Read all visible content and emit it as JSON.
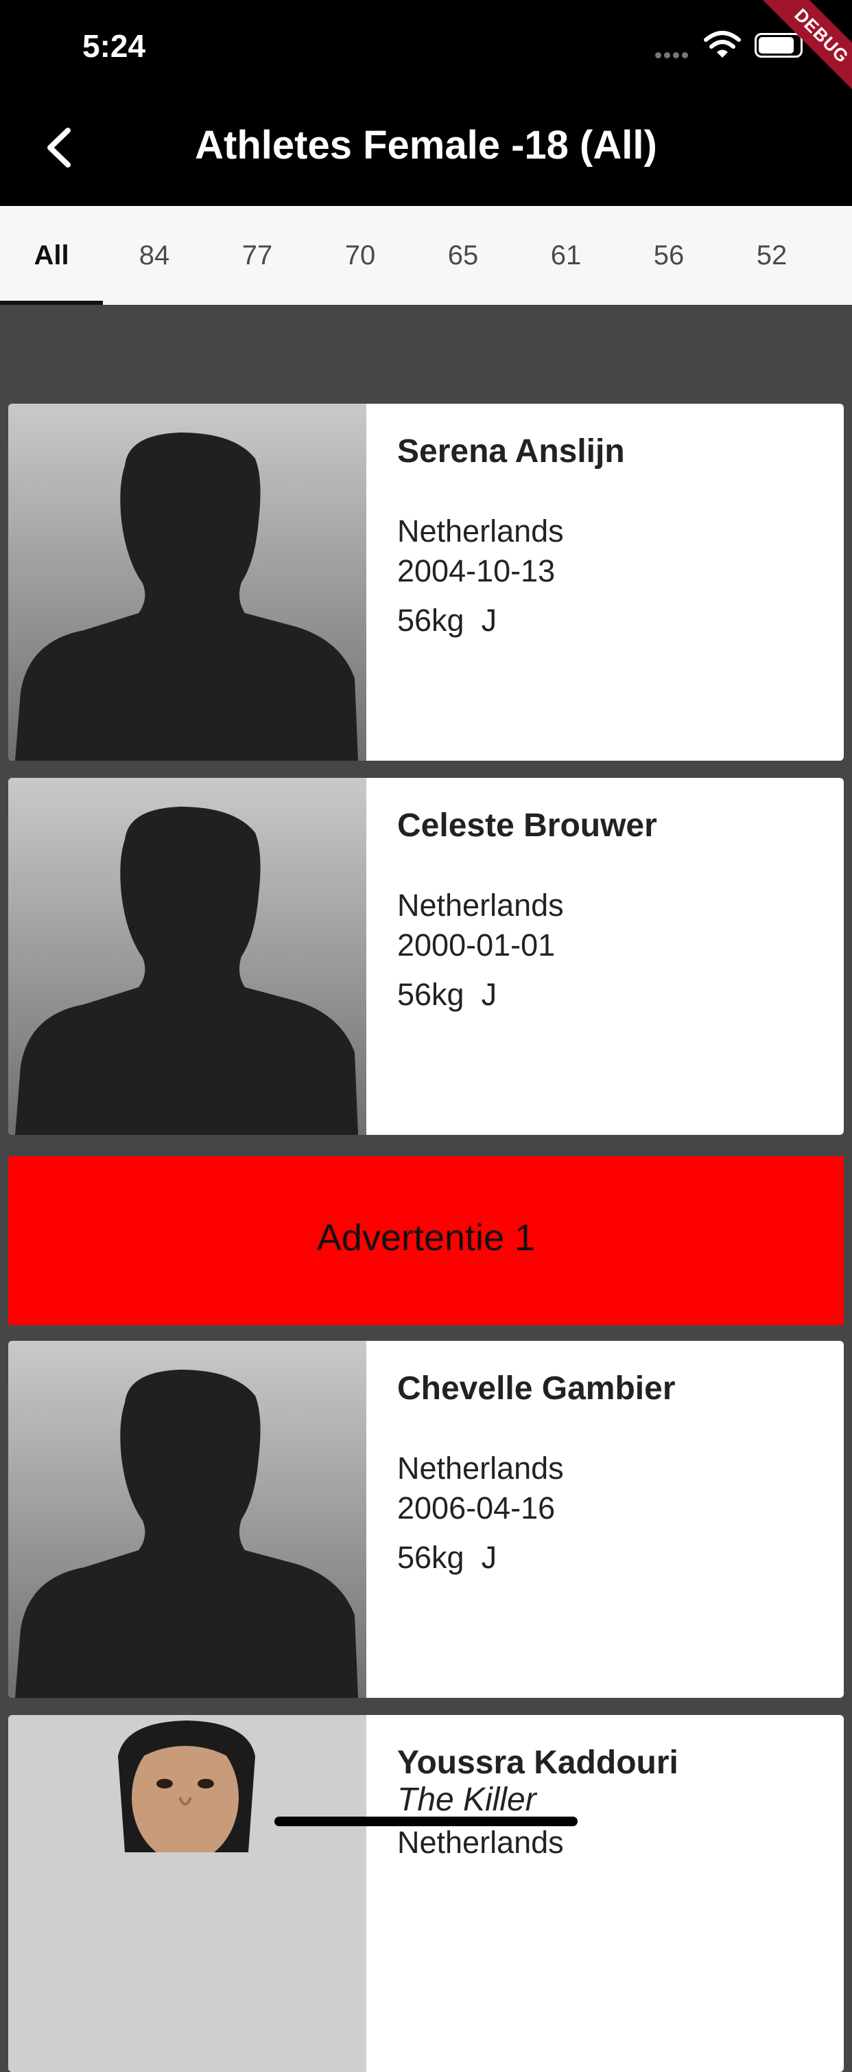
{
  "status_bar": {
    "time": "5:24",
    "debug_label": "DEBUG"
  },
  "app_bar": {
    "title": "Athletes Female -18 (All)",
    "back_icon": "chevron-left-icon"
  },
  "tabs": [
    {
      "label": "All",
      "active": true
    },
    {
      "label": "84"
    },
    {
      "label": "77"
    },
    {
      "label": "70"
    },
    {
      "label": "65"
    },
    {
      "label": "61"
    },
    {
      "label": "56"
    },
    {
      "label": "52"
    }
  ],
  "athletes": [
    {
      "name": "Serena Anslijn",
      "country": "Netherlands",
      "dob": "2004-10-13",
      "weight": "56kg",
      "category": "J",
      "photo": "placeholder"
    },
    {
      "name": "Celeste Brouwer",
      "country": "Netherlands",
      "dob": "2000-01-01",
      "weight": "56kg",
      "category": "J",
      "photo": "placeholder"
    },
    {
      "name": "Chevelle Gambier",
      "country": "Netherlands",
      "dob": "2006-04-16",
      "weight": "56kg",
      "category": "J",
      "photo": "placeholder"
    },
    {
      "name": "Youssra Kaddouri",
      "nickname": "The Killer",
      "country": "Netherlands",
      "photo": "portrait"
    }
  ],
  "ad": {
    "label": "Advertentie 1",
    "color": "#ff0000"
  }
}
